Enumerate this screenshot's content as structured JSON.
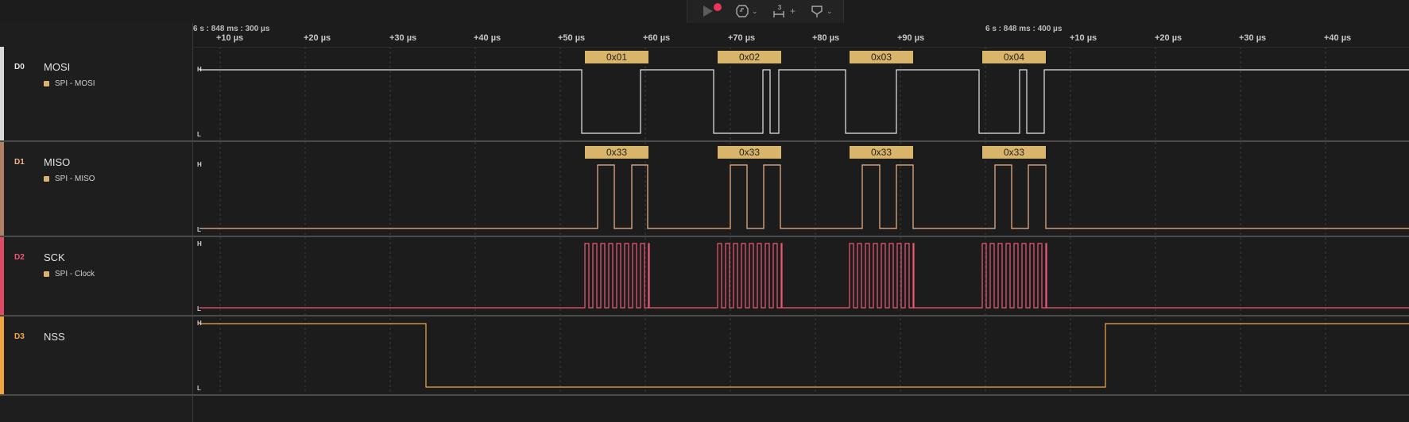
{
  "toolbar": {
    "play_icon": "play-icon",
    "record_indicator_color": "#e8355c",
    "trigger_icon": "trigger-icon",
    "measure_badge": "3",
    "marker_icon": "marker-icon"
  },
  "timeline": {
    "ref_left": "6 s : 848 ms : 300 µs",
    "ref_right": "6 s : 848 ms : 400 µs",
    "ticks": [
      "+10 µs",
      "+20 µs",
      "+30 µs",
      "+40 µs",
      "+50 µs",
      "+60 µs",
      "+70 µs",
      "+80 µs",
      "+90 µs",
      "+10 µs",
      "+20 µs",
      "+30 µs",
      "+40 µs"
    ]
  },
  "level_labels": {
    "high": "H",
    "low": "L"
  },
  "channels": [
    {
      "num": "D0",
      "name": "MOSI",
      "analyzer": "SPI - MOSI",
      "color": "#e6e6e6",
      "accent": "#d9d9d9",
      "bytes": [
        "0x01",
        "0x02",
        "0x03",
        "0x04"
      ]
    },
    {
      "num": "D1",
      "name": "MISO",
      "analyzer": "SPI - MISO",
      "color": "#f0b58a",
      "accent": "#b08066",
      "bytes": [
        "0x33",
        "0x33",
        "0x33",
        "0x33"
      ]
    },
    {
      "num": "D2",
      "name": "SCK",
      "analyzer": "SPI - Clock",
      "color": "#ee5a76",
      "accent": "#e04a67"
    },
    {
      "num": "D3",
      "name": "NSS",
      "color": "#f3a94d",
      "accent": "#f0a53f"
    }
  ],
  "colors": {
    "decode_box": "#d8b56b",
    "grid": "#3a3a3a"
  }
}
